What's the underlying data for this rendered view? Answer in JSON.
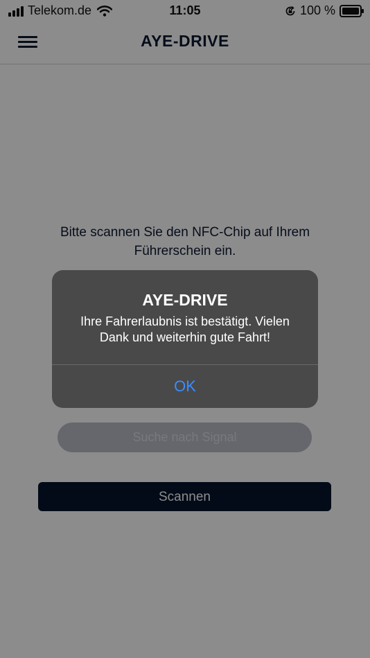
{
  "status_bar": {
    "carrier": "Telekom.de",
    "time": "11:05",
    "battery": "100 %",
    "icons": [
      "signal-bars-icon",
      "wifi-icon",
      "orientation-lock-icon",
      "battery-icon"
    ]
  },
  "nav": {
    "title": "AYE-DRIVE",
    "menu_icon": "hamburger-menu-icon"
  },
  "content": {
    "instruction": "Bitte scannen Sie den NFC-Chip auf Ihrem Führerschein ein.",
    "signal_status": "Suche nach Signal",
    "scan_button": "Scannen"
  },
  "alert": {
    "title": "AYE-DRIVE",
    "message": "Ihre Fahrerlaubnis ist bestätigt. Vielen Dank und weiterhin gute Fahrt!",
    "ok_button": "OK"
  },
  "colors": {
    "primary_dark": "#06142d",
    "alert_background": "#494949",
    "alert_action": "#3a8dff"
  }
}
